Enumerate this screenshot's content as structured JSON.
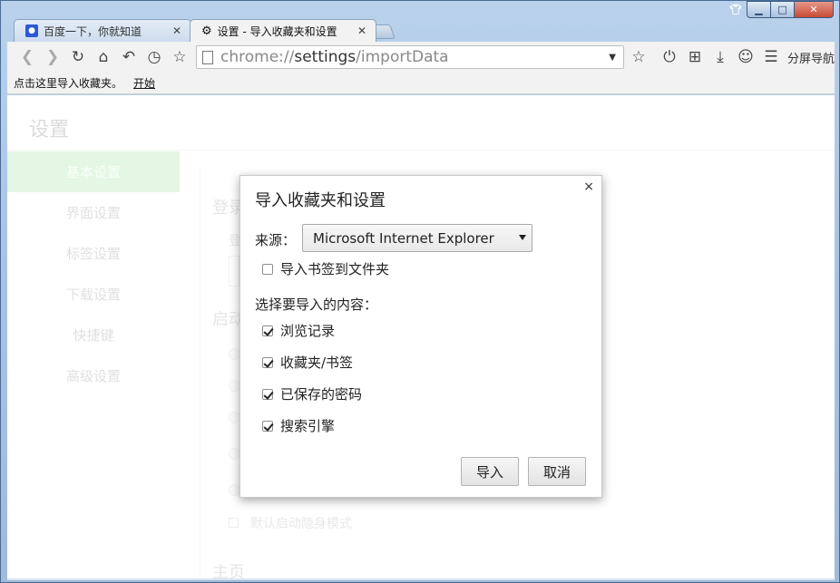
{
  "tabs": [
    {
      "title": "百度一下，你就知道",
      "favicon": "paw-icon"
    },
    {
      "title": "设置 - 导入收藏夹和设置",
      "favicon": "gear-icon"
    }
  ],
  "toolbar": {
    "url_scheme": "chrome://",
    "url_host": "settings",
    "url_path": "/importData",
    "split_nav_label": "分屏导航"
  },
  "bookmarks_bar": {
    "hint": "点击这里导入收藏夹。",
    "start_link": "开始"
  },
  "settings": {
    "title": "设置",
    "nav": [
      {
        "label": "基本设置",
        "active": true
      },
      {
        "label": "界面设置",
        "active": false
      },
      {
        "label": "标签设置",
        "active": false
      },
      {
        "label": "下载设置",
        "active": false
      },
      {
        "label": "快捷键",
        "active": false
      },
      {
        "label": "高级设置",
        "active": false
      }
    ],
    "bg_section_login": "登录",
    "bg_section_login_sub": "登",
    "bg_section_startup": "启动",
    "bg_incognito": "默认启动隐身模式",
    "bg_section_home": "主页"
  },
  "dialog": {
    "title": "导入收藏夹和设置",
    "source_label": "来源：",
    "source_value": "Microsoft Internet Explorer",
    "import_to_folder": {
      "label": "导入书签到文件夹",
      "checked": false
    },
    "select_label": "选择要导入的内容：",
    "items": [
      {
        "label": "浏览记录",
        "checked": true
      },
      {
        "label": "收藏夹/书签",
        "checked": true
      },
      {
        "label": "已保存的密码",
        "checked": true
      },
      {
        "label": "搜索引擎",
        "checked": true
      }
    ],
    "import_button": "导入",
    "cancel_button": "取消",
    "close_glyph": "×"
  },
  "colors": {
    "nav_active_bg": "#d6f2d6",
    "frame": "#a9c4e2"
  }
}
